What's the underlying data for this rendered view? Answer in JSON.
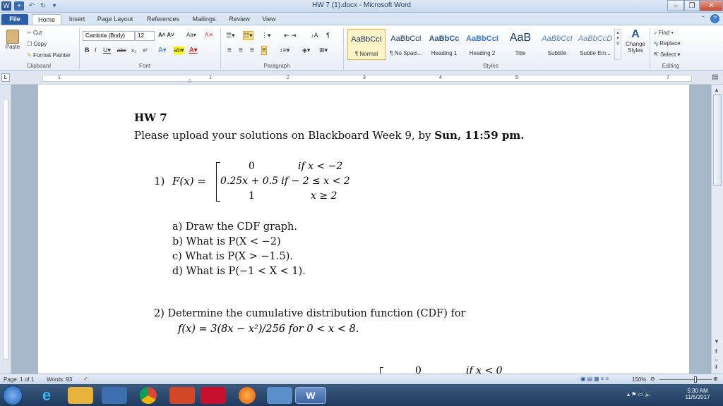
{
  "window": {
    "title": "HW 7 (1).docx - Microsoft Word"
  },
  "tabs": [
    "File",
    "Home",
    "Insert",
    "Page Layout",
    "References",
    "Mailings",
    "Review",
    "View"
  ],
  "clipboard": {
    "cut": "Cut",
    "copy": "Copy",
    "paste": "Paste",
    "format_painter": "Format Painter",
    "label": "Clipboard"
  },
  "font": {
    "name": "Cambria (Body)",
    "size": "12",
    "label": "Font"
  },
  "paragraph": {
    "label": "Paragraph"
  },
  "styles": {
    "label": "Styles",
    "items": [
      {
        "sample": "AaBbCcI",
        "name": "¶ Normal"
      },
      {
        "sample": "AaBbCcI",
        "name": "¶ No Spaci..."
      },
      {
        "sample": "AaBbCc",
        "name": "Heading 1"
      },
      {
        "sample": "AaBbCcI",
        "name": "Heading 2"
      },
      {
        "sample": "AaB",
        "name": "Title"
      },
      {
        "sample": "AaBbCcI",
        "name": "Subtitle"
      },
      {
        "sample": "AaBbCcD",
        "name": "Subtle Em..."
      }
    ],
    "change_styles": "Change Styles"
  },
  "editing": {
    "find": "Find",
    "replace": "Replace",
    "select": "Select",
    "label": "Editing"
  },
  "ruler": {
    "numbers": [
      "1",
      "1",
      "2",
      "3",
      "4",
      "5",
      "7"
    ]
  },
  "document": {
    "heading": "HW 7",
    "instruction_prefix": "Please upload your solutions on Blackboard Week 9, by ",
    "instruction_bold": "Sun, 11:59 pm.",
    "q1": {
      "number": "1)",
      "lhs": "F(x) =",
      "cases": [
        {
          "value": "0",
          "condition": "if x < −2"
        },
        {
          "value": "0.25x + 0.5 if − 2 ≤ x < 2",
          "condition": ""
        },
        {
          "value": "1",
          "condition": "x ≥ 2"
        }
      ],
      "parts": [
        "a)  Draw the CDF graph.",
        "b)  What is P(X < −2)",
        "c)  What is P(X > −1.5).",
        "d)  What is P(−1 < X < 1)."
      ]
    },
    "q2": {
      "line1": "2)  Determine the cumulative distribution function (CDF) for",
      "line2": "f(x) = 3(8x − x²)/256 for 0 < x < 8."
    },
    "q3_partial": {
      "value": "0",
      "condition": "if x < 0"
    }
  },
  "status": {
    "page": "Page: 1 of 1",
    "words": "Words: 93",
    "zoom": "150%"
  },
  "clock": {
    "time": "5:30 AM",
    "date": "11/5/2017"
  }
}
